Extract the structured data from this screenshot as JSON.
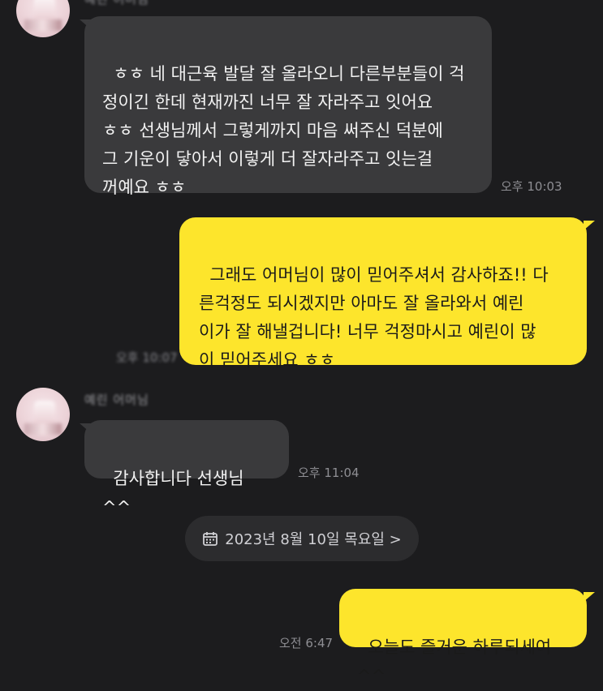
{
  "chat": {
    "messages": [
      {
        "id": "m1",
        "direction": "incoming",
        "text": "ㅎㅎ 네 대근육 발달 잘 올라오니 다른부분들이 걱\n정이긴 한데 현재까진 너무 잘 자라주고 잇어요\nㅎㅎ 선생님께서 그렇게까지 마음 써주신 덕분에\n그 기운이 닿아서 이렇게 더 잘자라주고 잇는걸\n꺼예요 ㅎㅎ",
        "time": "오후 10:03"
      },
      {
        "id": "m2",
        "direction": "outgoing",
        "text": "그래도 어머님이 많이 믿어주셔서 감사하죠!! 다\n른걱정도 되시겠지만 아마도 잘 올라와서 예린\n이가 잘 해낼겁니다! 너무 걱정마시고 예린이 많\n이 믿어주세요 ㅎㅎ",
        "time": "오후 10:07"
      },
      {
        "id": "m3",
        "direction": "incoming",
        "sender": "예린 어머님",
        "text": "감사합니다 선생님 ^^",
        "time": "오후 11:04"
      },
      {
        "id": "m4",
        "direction": "outgoing",
        "text": "오늘도 즐거운 하루되세여^^",
        "time": "오전 6:47"
      }
    ],
    "date_divider": {
      "label": "2023년 8월 10일 목요일 >",
      "icon": "calendar-icon"
    },
    "top_sender_cut": "예린 어머님"
  },
  "colors": {
    "background": "#1c1c1e",
    "incoming_bubble": "#3a3a3c",
    "outgoing_bubble": "#fde52c"
  }
}
